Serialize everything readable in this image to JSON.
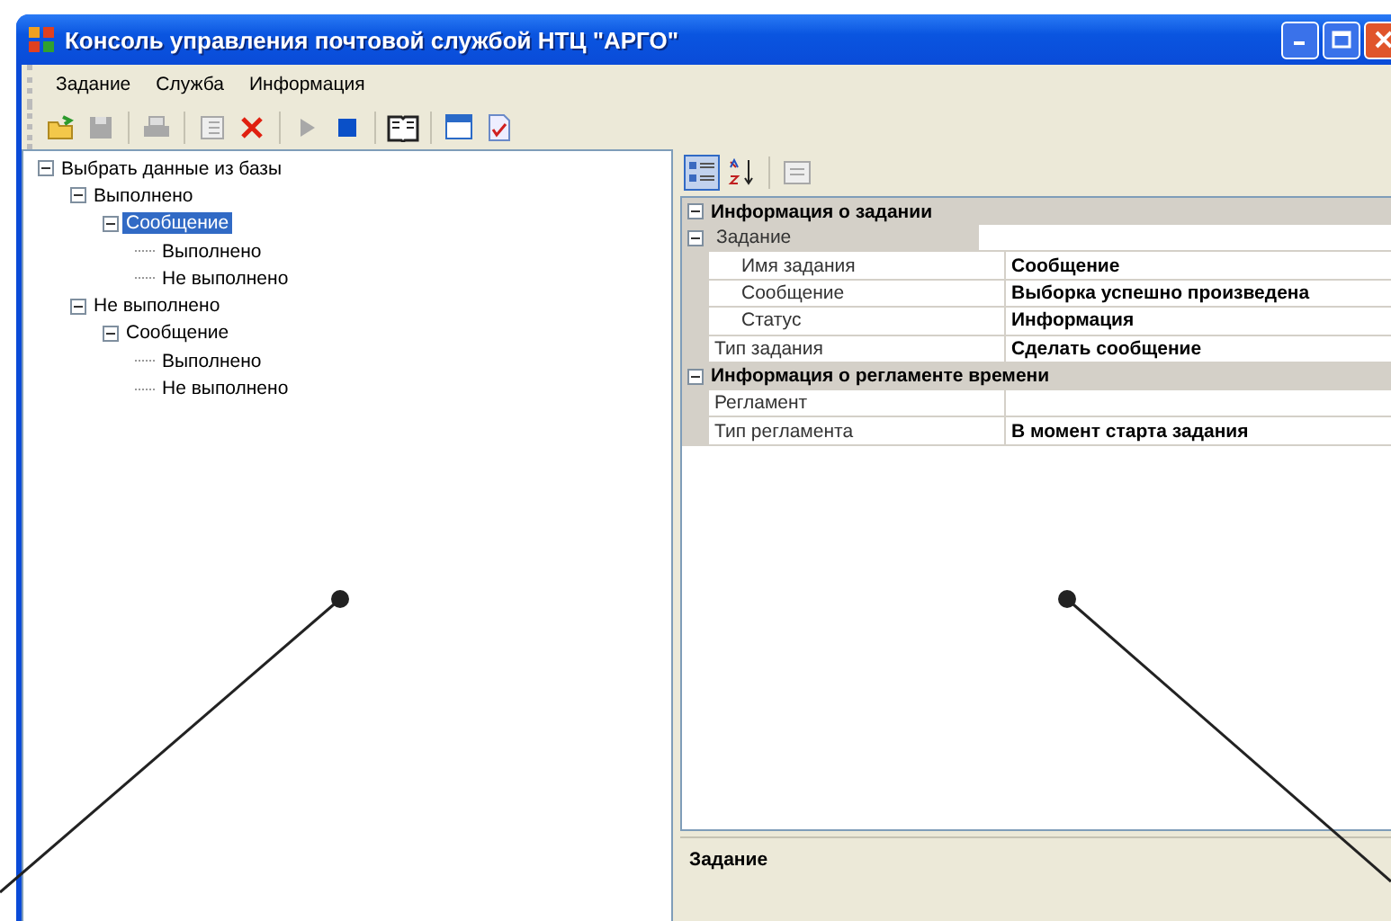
{
  "window": {
    "title": "Консоль управления почтовой службой НТЦ \"АРГО\""
  },
  "menu": [
    "Задание",
    "Служба",
    "Информация"
  ],
  "toolbar": [
    {
      "kind": "open",
      "disabled": false
    },
    {
      "kind": "save",
      "disabled": true
    },
    {
      "kind": "separator"
    },
    {
      "kind": "print",
      "disabled": true
    },
    {
      "kind": "separator"
    },
    {
      "kind": "list",
      "disabled": true
    },
    {
      "kind": "delete",
      "disabled": false
    },
    {
      "kind": "separator"
    },
    {
      "kind": "play",
      "disabled": true
    },
    {
      "kind": "stop",
      "disabled": false
    },
    {
      "kind": "separator"
    },
    {
      "kind": "book",
      "disabled": false
    },
    {
      "kind": "separator"
    },
    {
      "kind": "calendar",
      "disabled": false
    },
    {
      "kind": "report",
      "disabled": false
    }
  ],
  "tree": [
    {
      "label": "Выбрать данные из базы",
      "expanded": true,
      "selected": false,
      "children": [
        {
          "label": "Выполнено",
          "expanded": true,
          "selected": false,
          "children": [
            {
              "label": "Сообщение",
              "expanded": true,
              "selected": true,
              "children": [
                {
                  "label": "Выполнено",
                  "selected": false
                },
                {
                  "label": "Не выполнено",
                  "selected": false
                }
              ]
            }
          ]
        },
        {
          "label": "Не выполнено",
          "expanded": true,
          "selected": false,
          "children": [
            {
              "label": "Сообщение",
              "expanded": true,
              "selected": false,
              "children": [
                {
                  "label": "Выполнено",
                  "selected": false
                },
                {
                  "label": "Не выполнено",
                  "selected": false
                }
              ]
            }
          ]
        }
      ]
    }
  ],
  "property_grid": {
    "toolbar": [
      {
        "kind": "categorized",
        "selected": true
      },
      {
        "kind": "alphabetical",
        "selected": false
      },
      {
        "kind": "separator"
      },
      {
        "kind": "pages",
        "disabled": true
      }
    ],
    "categories": [
      {
        "label": "Информация о задании",
        "expanded": true,
        "rows": [
          {
            "label": "Задание",
            "expanded": true,
            "children": [
              {
                "label": "Имя задания",
                "value": "Сообщение"
              },
              {
                "label": "Сообщение",
                "value": "Выборка успешно произведена"
              },
              {
                "label": "Статус",
                "value": "Информация"
              }
            ]
          },
          {
            "label": "Тип задания",
            "value": "Сделать сообщение"
          }
        ]
      },
      {
        "label": "Информация о регламенте времени",
        "expanded": true,
        "rows": [
          {
            "label": "Регламент"
          },
          {
            "label": "Тип регламента",
            "value": "В момент старта задания"
          }
        ]
      }
    ],
    "description": {
      "title": "Задание"
    }
  }
}
